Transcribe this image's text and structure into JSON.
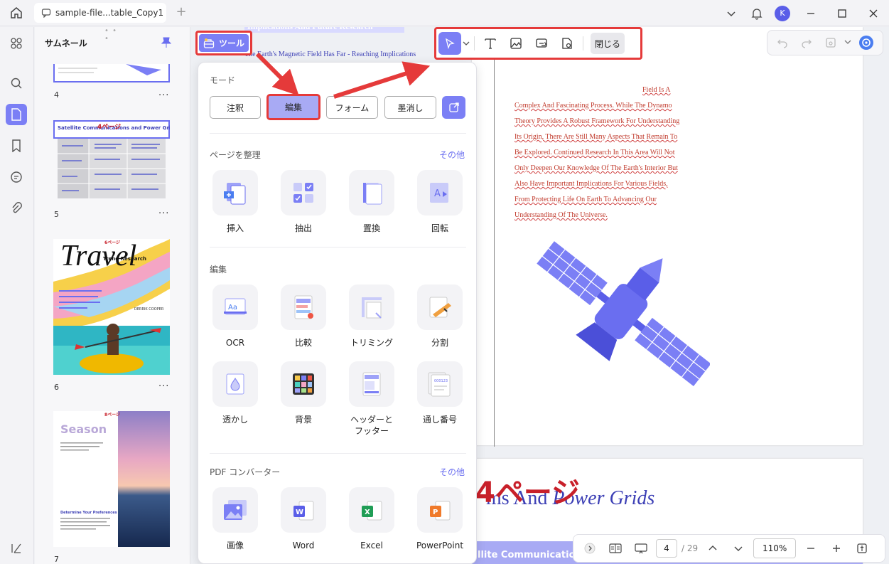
{
  "titlebar": {
    "tab_title": "sample-file...table_Copy1",
    "avatar_initial": "K"
  },
  "thumbnails": {
    "header": "サムネール",
    "pages": [
      {
        "num": "4",
        "more": "···"
      },
      {
        "num": "5",
        "more": "···",
        "title": "Satellite Communications and Power Grids",
        "stamp": "4ページ"
      },
      {
        "num": "6",
        "more": "···",
        "title": "Travel",
        "sub": "Trend Research",
        "stamp": "6ページ",
        "author": "DERRIK COOPER"
      },
      {
        "num": "7",
        "more": "···",
        "title": "Season",
        "stamp": "8ページ",
        "sub": "Determine Your Preferences"
      }
    ]
  },
  "tools_button": {
    "label": "ツール"
  },
  "edit_toolbar": {
    "close_label": "閉じる"
  },
  "tools_panel": {
    "mode_title": "モード",
    "modes": [
      "注釈",
      "編集",
      "フォーム",
      "墨消し"
    ],
    "organize": {
      "title": "ページを整理",
      "more": "その他",
      "items": [
        "挿入",
        "抽出",
        "置換",
        "回転"
      ]
    },
    "edit": {
      "title": "編集",
      "items": [
        "OCR",
        "比較",
        "トリミング",
        "分割",
        "透かし",
        "背景",
        "ヘッダーと\nフッター",
        "通し番号"
      ]
    },
    "convert": {
      "title": "PDF コンバーター",
      "more": "その他",
      "items": [
        "画像",
        "Word",
        "Excel",
        "PowerPoint"
      ]
    }
  },
  "document": {
    "top_heading": "Implications And Future Research",
    "left_line": "The Earth's Magnetic Field Has Far - Reaching Implications",
    "paragraph": [
      "Field Is A",
      "Complex And Fascinating Process. While The Dynamo",
      "Theory Provides A Robust Framework For Understanding",
      "Its Origin, There Are Still Many Aspects That Remain To",
      "Be Explored. Continued Research In This Area Will Not",
      "Only Deepen Our Knowledge Of The Earth's Interior But",
      "Also Have Important Implications For Various Fields,",
      "From Protecting Life On Earth To Advancing Our",
      "Understanding Of The Universe."
    ],
    "page2_heading_a": "ms And ",
    "page2_heading_b": "Power Grids",
    "page2_stamp": "4ページ",
    "page2_band": "llite Communications"
  },
  "statusbar": {
    "current_page": "4",
    "total_pages": "/ 29",
    "zoom": "110%"
  },
  "colors": {
    "accent": "#7b7ff5",
    "highlight_border": "#e53a3a",
    "doc_blue": "#3c3fb5",
    "stamp_red": "#c8202a"
  }
}
